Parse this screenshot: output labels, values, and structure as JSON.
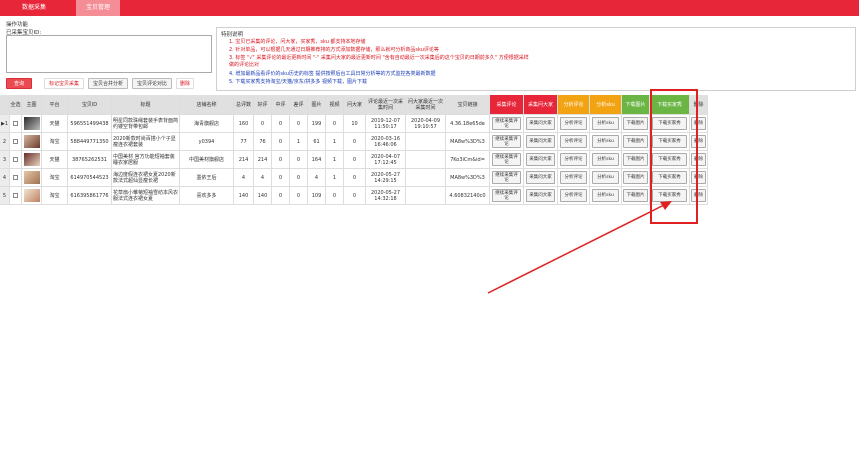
{
  "topbar": {
    "tabs": [
      {
        "label": "数据采集"
      },
      {
        "label": "宝贝管理"
      }
    ]
  },
  "left_panel": {
    "section_title": "操作功能",
    "collected_label": "已采集宝贝ID:",
    "textarea_value": "",
    "buttons": {
      "query": "查询",
      "mark_collected": "标记宝贝采集",
      "sort_analysis": "宝贝合并分析",
      "compare_reviews": "宝贝评论对比",
      "delete": "删除"
    }
  },
  "notes": {
    "title": "特别说明",
    "lines": [
      "1. 宝贝已采集的评论，问大家，买家秀，sku 都支持本地存储",
      "2. 针对单品，可以根据几天通过日期推荐排的方式添加数据存储，那么就可分析商品sku评论等",
      "3. 标签 \"√\" 采集评论的最近更新时间 \"-\" 采集问大家的最近更新时间 \"含有自动最近一次采集后的这个宝贝的日期前多久\" 方便根据采样做的评论比对",
      "4. 增加最新品看评价的sku历史的标签 提供按照后台工具日常分析等的方式监控各类最新数据",
      "5. 下载买家秀支持淘宝/天猫/京东/拼多多 视频下载，图片下载"
    ]
  },
  "table": {
    "headers": [
      "全选",
      "主图",
      "平台",
      "宝贝ID",
      "标题",
      "店铺名称",
      "总评数",
      "好评",
      "中评",
      "差评",
      "图片",
      "视频",
      "问大家",
      "评论最近一次采集时间",
      "问大家最近一次采集时间",
      "宝贝链接",
      "采集评论",
      "采集问大家",
      "分析评论",
      "分析sku",
      "下载图片",
      "下载买家秀",
      "删除"
    ],
    "rows": [
      {
        "platform": "天猫",
        "id": "596551499438",
        "title": "明星同款珠绳套装手表背面简约镂空背带包邮",
        "shop": "海青旗舰店",
        "total": "160",
        "good": "0",
        "mid": "0",
        "bad": "0",
        "pic": "199",
        "video": "0",
        "ask": "10",
        "review_time": "2019-12-07 11:50:17",
        "ask_time": "2020-04-09 19:10:57",
        "link": "4.36.18e65de",
        "collect_review": "继续采集评论",
        "collect_ask": "采集问大家",
        "analyze_review": "分析评论",
        "analyze_sku": "分析sku",
        "download_pic": "下载图片",
        "download_show": "下载买家秀",
        "delete": "删除"
      },
      {
        "platform": "淘宝",
        "id": "588449771350",
        "title": "2020新款时尚百搭小个子显瘦连衣裙套装",
        "shop": "y0394",
        "total": "77",
        "good": "76",
        "mid": "0",
        "bad": "1",
        "pic": "61",
        "video": "1",
        "ask": "0",
        "review_time": "2020-03-16 16:46:06",
        "ask_time": "",
        "link": "MA8w%3D%3",
        "collect_review": "继续采集评论",
        "collect_ask": "采集问大家",
        "analyze_review": "分析评论",
        "analyze_sku": "分析sku",
        "download_pic": "下载图片",
        "download_show": "下载买家秀",
        "delete": "删除"
      },
      {
        "platform": "天猫",
        "id": "38765262531",
        "title": "中国美材 官方功能短袖套装睡衣家居服",
        "shop": "中国美材旗舰店",
        "total": "214",
        "good": "214",
        "mid": "0",
        "bad": "0",
        "pic": "164",
        "video": "1",
        "ask": "0",
        "review_time": "2020-04-07 17:12:45",
        "ask_time": "",
        "link": "7Ko3iCm&id=",
        "collect_review": "继续采集评论",
        "collect_ask": "采集问大家",
        "analyze_review": "分析评论",
        "analyze_sku": "分析sku",
        "download_pic": "下载图片",
        "download_show": "下载买家秀",
        "delete": "删除"
      },
      {
        "platform": "淘宝",
        "id": "614970544523",
        "title": "海边度假连衣裙女夏2020新款法式超仙显瘦长裙",
        "shop": "墨依王后",
        "total": "4",
        "good": "4",
        "mid": "0",
        "bad": "0",
        "pic": "4",
        "video": "1",
        "ask": "0",
        "review_time": "2020-05-27 14:29:15",
        "ask_time": "",
        "link": "MA8w%3D%3",
        "collect_review": "继续采集评论",
        "collect_ask": "采集问大家",
        "analyze_review": "分析评论",
        "analyze_sku": "分析sku",
        "download_pic": "下载图片",
        "download_show": "下载买家秀",
        "delete": "删除"
      },
      {
        "platform": "淘宝",
        "id": "616395861776",
        "title": "花草扇小雏菊短袖雪纺本风衣服法式连衣裙女夏",
        "shop": "喜欢多多",
        "total": "140",
        "good": "140",
        "mid": "0",
        "bad": "0",
        "pic": "109",
        "video": "0",
        "ask": "0",
        "review_time": "2020-05-27 14:32:18",
        "ask_time": "",
        "link": "4.60832140c0",
        "collect_review": "继续采集评论",
        "collect_ask": "采集问大家",
        "analyze_review": "分析评论",
        "analyze_sku": "分析sku",
        "download_pic": "下载图片",
        "download_show": "下载买家秀",
        "delete": "删除"
      }
    ],
    "row_numbers": [
      "1",
      "2",
      "3",
      "4",
      "5"
    ],
    "current_row_marker": "▶"
  },
  "colors": {
    "brand_red": "#e8263a",
    "orange": "#f2a312",
    "green": "#6ab544",
    "highlight": "#e02020"
  }
}
